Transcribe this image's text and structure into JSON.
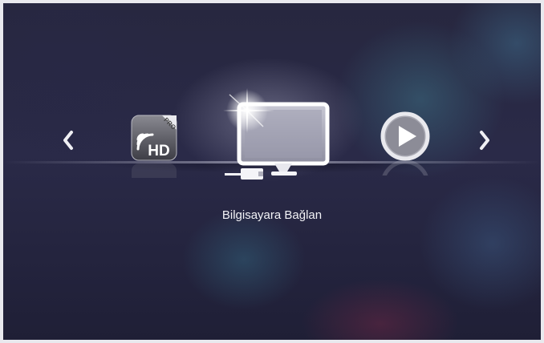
{
  "menu": {
    "selected_title": "Bilgisayara Bağlan",
    "items": [
      {
        "id": "wifi-hd-pro",
        "icon": "wireless-hd-pro-icon",
        "badge": "PRO",
        "text": "HD"
      },
      {
        "id": "pc-connect",
        "icon": "computer-monitor-icon",
        "selected": true
      },
      {
        "id": "media-player",
        "icon": "play-icon"
      }
    ]
  },
  "navigation": {
    "left_icon": "chevron-left-icon",
    "right_icon": "chevron-right-icon"
  },
  "colors": {
    "background": "#27273f",
    "text": "#f2f2f6",
    "icon": "#e6e6ea"
  }
}
